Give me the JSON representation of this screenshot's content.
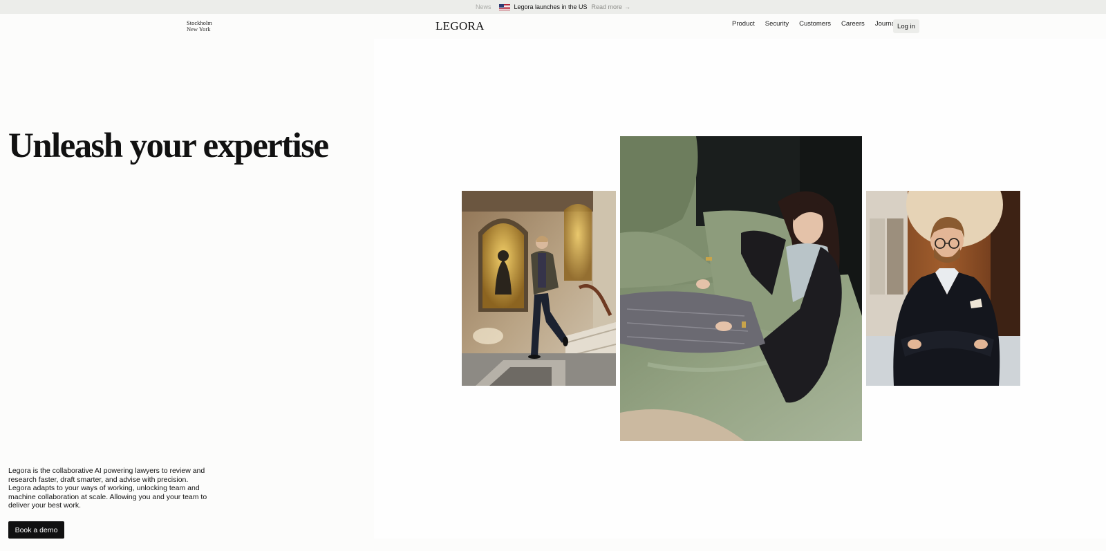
{
  "announcement": {
    "news_label": "News",
    "flag_icon": "us-flag-icon",
    "headline": "Legora launches in the US",
    "read_more": "Read more",
    "arrow": "→"
  },
  "header": {
    "cities": [
      "Stockholm",
      "New York"
    ],
    "logo": "LEGORA",
    "nav": [
      "Product",
      "Security",
      "Customers",
      "Careers",
      "Journal"
    ],
    "login": "Log in"
  },
  "hero": {
    "title": "Unleash your expertise",
    "description": "Legora is the collaborative AI powering lawyers to review and research faster, draft smarter, and advise with precision. Legora adapts to your ways of working, unlocking team and machine collaboration at scale. Allowing you and your team to deliver your best work.",
    "cta": "Book a demo"
  },
  "colors": {
    "background": "#fcfcfb",
    "announcement_bg": "#ecedea",
    "button_bg": "#111111",
    "sofa_green": "#8e9d7c"
  }
}
